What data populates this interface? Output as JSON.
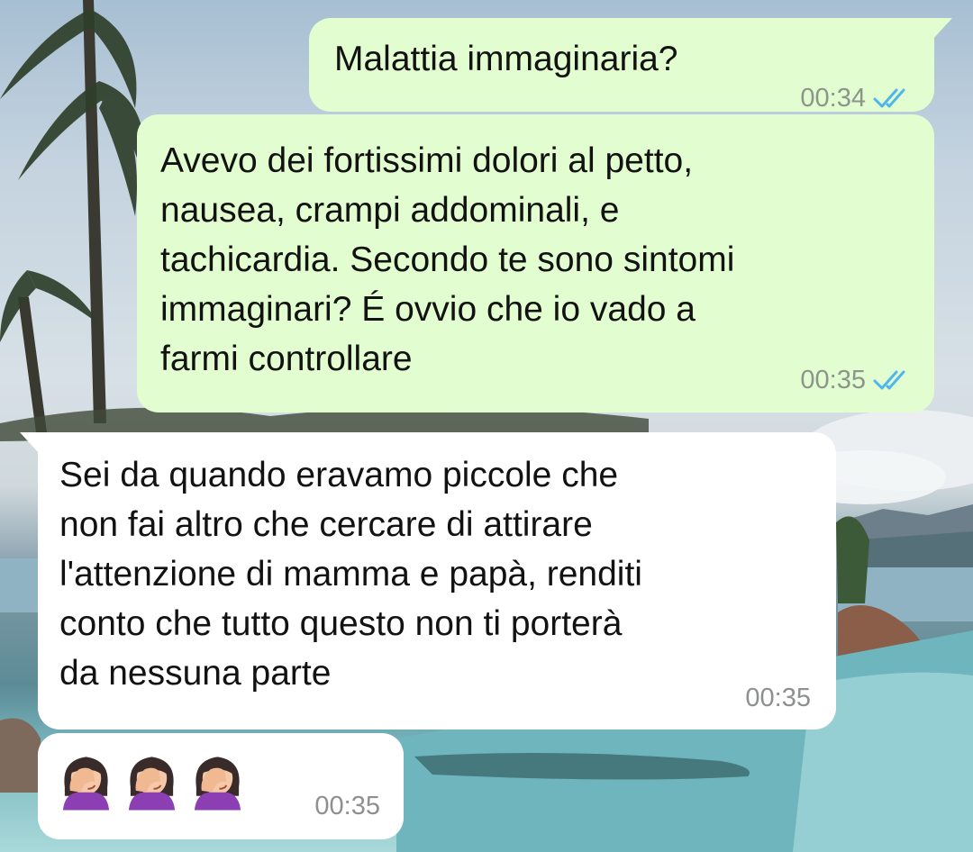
{
  "messages": [
    {
      "direction": "outgoing",
      "text": "Malattia immaginaria?",
      "time": "00:34",
      "status_icon": "double-check-icon",
      "status_color": "#4fb6ec"
    },
    {
      "direction": "outgoing",
      "text": "Avevo dei fortissimi dolori al petto,\nnausea, crampi addominali, e\ntachicardia. Secondo te sono sintomi\nimmaginari? É ovvio che io vado a\nfarmi controllare",
      "time": "00:35",
      "status_icon": "double-check-icon",
      "status_color": "#4fb6ec"
    },
    {
      "direction": "incoming",
      "text": "Sei da quando eravamo piccole che\nnon fai altro che cercare di attirare\nl'attenzione di mamma e papà, renditi\nconto che tutto questo non ti porterà\nda nessuna parte",
      "time": "00:35"
    },
    {
      "direction": "incoming",
      "emojis": [
        "face-palm-woman-icon",
        "face-palm-woman-icon",
        "face-palm-woman-icon"
      ],
      "time": "00:35"
    }
  ],
  "colors": {
    "outgoing_bubble": "#e2fdcf",
    "incoming_bubble": "#ffffff",
    "read_tick": "#4fb6ec",
    "timestamp": "#8c958d"
  }
}
